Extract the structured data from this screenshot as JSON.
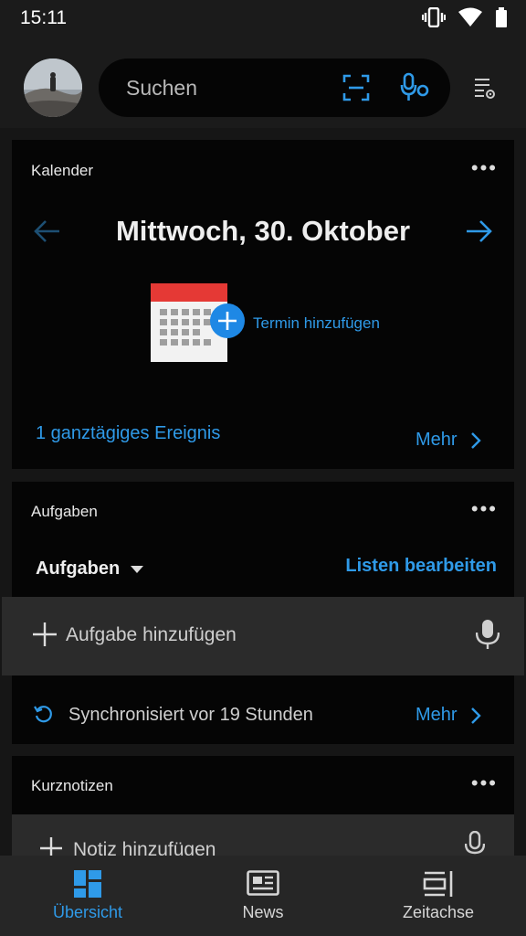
{
  "status_bar": {
    "time": "15:11"
  },
  "header": {
    "search_placeholder": "Suchen"
  },
  "calendar": {
    "title": "Kalender",
    "date": "Mittwoch, 30. Oktober",
    "add_event": "Termin hinzufügen",
    "all_day": "1 ganztägiges Ereignis",
    "more": "Mehr"
  },
  "tasks": {
    "title": "Aufgaben",
    "list_name": "Aufgaben",
    "edit_lists": "Listen bearbeiten",
    "add_task": "Aufgabe hinzufügen",
    "sync_status": "Synchronisiert vor 19 Stunden",
    "more": "Mehr"
  },
  "notes": {
    "title": "Kurznotizen",
    "add_note": "Notiz hinzufügen"
  },
  "bottom_nav": {
    "items": [
      {
        "label": "Übersicht",
        "icon": "dashboard-icon",
        "active": true
      },
      {
        "label": "News",
        "icon": "news-icon",
        "active": false
      },
      {
        "label": "Zeitachse",
        "icon": "timeline-icon",
        "active": false
      }
    ]
  },
  "colors": {
    "accent": "#2f9ae8",
    "card": "#050505",
    "background": "#161616"
  }
}
